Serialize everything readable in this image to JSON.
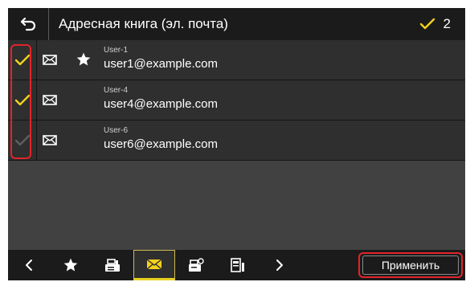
{
  "header": {
    "title": "Адресная книга (эл. почта)",
    "selected_count": "2"
  },
  "entries": [
    {
      "name": "User-1",
      "email": "user1@example.com",
      "checked": true,
      "favorite": true
    },
    {
      "name": "User-4",
      "email": "user4@example.com",
      "checked": true,
      "favorite": false
    },
    {
      "name": "User-6",
      "email": "user6@example.com",
      "checked": false,
      "favorite": false
    }
  ],
  "toolbar": {
    "items": [
      "chevron-left-icon",
      "star-icon",
      "fax-icon",
      "mail-icon",
      "i-fax-icon",
      "file-server-icon",
      "chevron-right-icon"
    ],
    "active": "mail-icon",
    "apply_label": "Применить"
  },
  "colors": {
    "check_on": "#f2d21c",
    "check_off": "#5e5e5e",
    "highlight": "#e2232a",
    "background": "#414141",
    "bar": "#1b1b1b"
  }
}
